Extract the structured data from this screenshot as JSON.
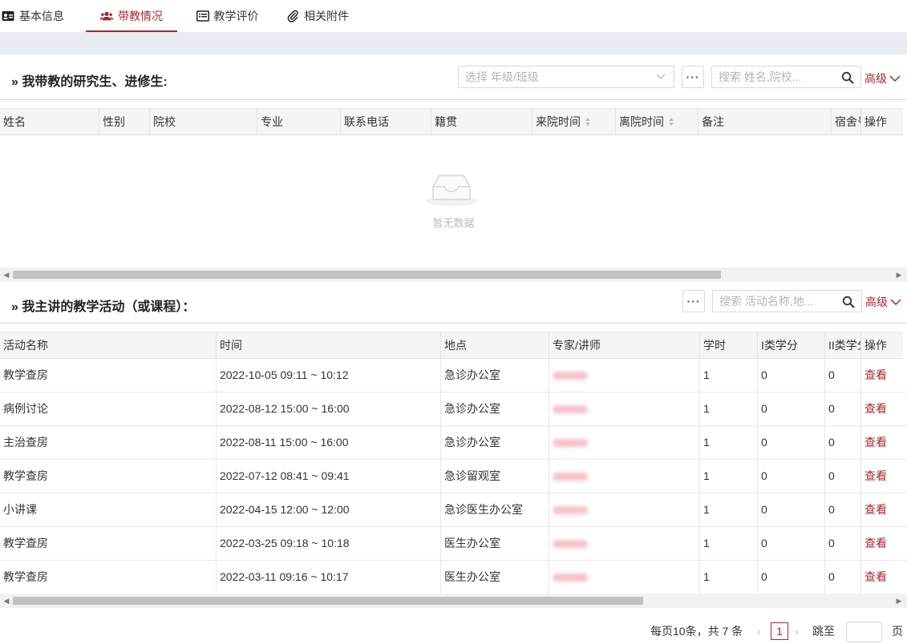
{
  "tabs": [
    {
      "label": "基本信息",
      "icon": "id-card-icon"
    },
    {
      "label": "带教情况",
      "icon": "users-icon",
      "active": true
    },
    {
      "label": "教学评价",
      "icon": "list-icon"
    },
    {
      "label": "相关附件",
      "icon": "paperclip-icon"
    }
  ],
  "section1": {
    "title": "» 我带教的研究生、进修生:",
    "select_placeholder": "选择 年级/班级",
    "more_label": "···",
    "search_placeholder": "搜索 姓名,院校...",
    "advanced_label": "高级",
    "columns": [
      "姓名",
      "性别",
      "院校",
      "专业",
      "联系电话",
      "籍贯",
      "来院时间",
      "离院时间",
      "备注",
      "宿舍号",
      "操作"
    ],
    "empty_text": "暂无数据"
  },
  "section2": {
    "title": "» 我主讲的教学活动（或课程）：",
    "more_label": "···",
    "search_placeholder": "搜索 活动名称,地...",
    "advanced_label": "高级",
    "columns": [
      "活动名称",
      "时间",
      "地点",
      "专家/讲师",
      "学时",
      "I类学分",
      "II类学分",
      "操作"
    ],
    "rows": [
      {
        "name": "教学查房",
        "time": "2022-10-05 09:11 ~ 10:12",
        "place": "急诊办公室",
        "hours": "1",
        "c1": "0",
        "c2": "0",
        "action": "查看"
      },
      {
        "name": "病例讨论",
        "time": "2022-08-12 15:00 ~ 16:00",
        "place": "急诊办公室",
        "hours": "1",
        "c1": "0",
        "c2": "0",
        "action": "查看"
      },
      {
        "name": "主治查房",
        "time": "2022-08-11 15:00 ~ 16:00",
        "place": "急诊办公室",
        "hours": "1",
        "c1": "0",
        "c2": "0",
        "action": "查看"
      },
      {
        "name": "教学查房",
        "time": "2022-07-12 08:41 ~ 09:41",
        "place": "急诊留观室",
        "hours": "1",
        "c1": "0",
        "c2": "0",
        "action": "查看"
      },
      {
        "name": "小讲课",
        "time": "2022-04-15 12:00 ~ 12:00",
        "place": "急诊医生办公室",
        "hours": "1",
        "c1": "0",
        "c2": "0",
        "action": "查看"
      },
      {
        "name": "教学查房",
        "time": "2022-03-25 09:18 ~ 10:18",
        "place": "医生办公室",
        "hours": "1",
        "c1": "0",
        "c2": "0",
        "action": "查看"
      },
      {
        "name": "教学查房",
        "time": "2022-03-11 09:16 ~ 10:17",
        "place": "医生办公室",
        "hours": "1",
        "c1": "0",
        "c2": "0",
        "action": "查看"
      }
    ]
  },
  "pagination": {
    "summary": "每页10条，共 7 条",
    "current_page": "1",
    "jump_label": "跳至",
    "page_suffix": "页"
  },
  "colors": {
    "accent": "#a82a2a",
    "band": "#e9ecf2",
    "header_bg": "#f5f5f5"
  }
}
